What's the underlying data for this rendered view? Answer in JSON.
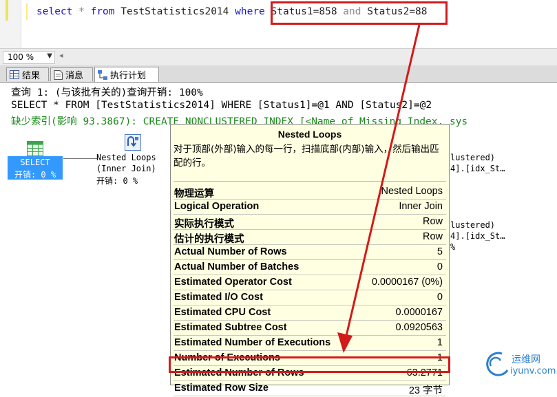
{
  "editor": {
    "query": {
      "kw_select": "select",
      "star": "*",
      "kw_from": "from",
      "table": "TestStatistics2014",
      "kw_where": "where",
      "cond1": "Status1=858",
      "kw_and": "and",
      "cond2": "Status2=88"
    }
  },
  "toolbar": {
    "zoom": "100 %"
  },
  "tabs": [
    {
      "label": "结果",
      "icon": "grid-icon"
    },
    {
      "label": "消息",
      "icon": "messages-icon"
    },
    {
      "label": "执行计划",
      "icon": "execution-plan-icon",
      "active": true
    }
  ],
  "plan": {
    "query_header": "查询 1: (与该批有关的)查询开销: 100%",
    "statement": "SELECT * FROM [TestStatistics2014] WHERE [Status1]=@1 AND [Status2]=@2",
    "missing_index": "缺少索引(影响 93.3867): CREATE NONCLUSTERED INDEX [<Name of Missing Index, sys",
    "select_node": {
      "label": "SELECT",
      "cost": "开销: 0 %"
    },
    "nested_loops_node": {
      "label1": "Nested Loops",
      "label2": "(Inner Join)",
      "cost": "开销: 0 %"
    },
    "right_nodes": [
      {
        "line1": "lustered)",
        "line2": "4].[idx_St…"
      },
      {
        "line1": "lustered)",
        "line2": "4].[idx_St…",
        "line3": "%"
      }
    ]
  },
  "tooltip": {
    "title": "Nested Loops",
    "description": "对于顶部(外部)输入的每一行，扫描底部(内部)输入，然后输出匹配的行。",
    "rows": [
      {
        "key": "物理运算",
        "value": "Nested Loops"
      },
      {
        "key": "Logical Operation",
        "value": "Inner Join"
      },
      {
        "key": "实际执行模式",
        "value": "Row"
      },
      {
        "key": "估计的执行模式",
        "value": "Row"
      },
      {
        "key": "Actual Number of Rows",
        "value": "5"
      },
      {
        "key": "Actual Number of Batches",
        "value": "0"
      },
      {
        "key": "Estimated Operator Cost",
        "value": "0.0000167 (0%)"
      },
      {
        "key": "Estimated I/O Cost",
        "value": "0"
      },
      {
        "key": "Estimated CPU Cost",
        "value": "0.0000167"
      },
      {
        "key": "Estimated Subtree Cost",
        "value": "0.0920563"
      },
      {
        "key": "Estimated Number of Executions",
        "value": "1"
      },
      {
        "key": "Number of Executions",
        "value": "1"
      },
      {
        "key": "Estimated Number of Rows",
        "value": "63.2771"
      },
      {
        "key": "Estimated Row Size",
        "value": "23 字节"
      }
    ]
  },
  "annotation": {
    "color": "#d21a1a"
  },
  "watermark": {
    "line1": "运维网",
    "line2": "iyunv.com"
  }
}
